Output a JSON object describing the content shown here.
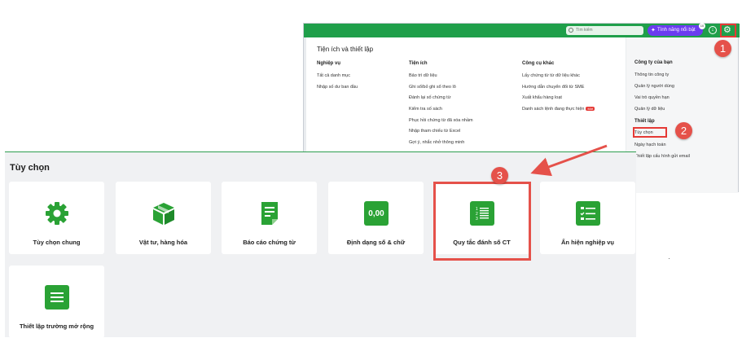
{
  "topbar": {
    "search_placeholder": "Tìm kiếm",
    "feature_button": "Tính năng nổi bật",
    "feature_badge": "10"
  },
  "menu": {
    "title": "Tiện ích và thiết lập",
    "columns": [
      {
        "head": "Nghiệp vụ",
        "items": [
          "Tất cả danh mục",
          "Nhập số dư ban đầu"
        ]
      },
      {
        "head": "Tiện ích",
        "items": [
          "Bảo trì dữ liệu",
          "Ghi sổ/bỏ ghi sổ theo lô",
          "Đánh lại số chứng từ",
          "Kiểm tra số sách",
          "Phục hồi chứng từ đã xóa nhầm",
          "Nhập tham chiếu từ Excel",
          "Gợi ý, nhắc nhở thông minh"
        ]
      },
      {
        "head": "Công cụ khác",
        "items": [
          "Lấy chứng từ từ dữ liệu khác",
          "Hướng dẫn chuyển đổi từ SME",
          "Xuất khẩu hàng loạt",
          "Danh sách lệnh đang thực hiện"
        ]
      }
    ],
    "new_tag": "Mới",
    "right": {
      "company_head": "Công ty của bạn",
      "company_items": [
        "Thông tin công ty",
        "Quản lý người dùng",
        "Vai trò quyền hạn",
        "Quản lý dữ liệu"
      ],
      "setup_head": "Thiết lập",
      "setup_items": [
        "Tùy chọn",
        "Ngày hạch toán",
        "Thiết lập cấu hình gửi email"
      ]
    }
  },
  "callouts": [
    "1",
    "2",
    "3"
  ],
  "options": {
    "title": "Tùy chọn",
    "cards": [
      {
        "label": "Tùy chọn chung",
        "icon": "gear-icon"
      },
      {
        "label": "Vật tư, hàng hóa",
        "icon": "box-icon"
      },
      {
        "label": "Báo cáo chứng từ",
        "icon": "document-icon"
      },
      {
        "label": "Định dạng số & chữ",
        "icon": "number-format-icon",
        "icon_text": "0,00"
      },
      {
        "label": "Quy tắc đánh số CT",
        "icon": "numbered-list-icon",
        "icon_text": "1\n2\n3"
      },
      {
        "label": "Ẩn hiện nghiệp vụ",
        "icon": "checklist-icon"
      },
      {
        "label": "Thiết lập trường mở rộng",
        "icon": "list-icon"
      }
    ]
  },
  "colors": {
    "brand_green": "#2aa235",
    "highlight_red": "#e5514a",
    "topbar_green": "#1f9f4a",
    "feature_purple": "#6b3cf0"
  }
}
